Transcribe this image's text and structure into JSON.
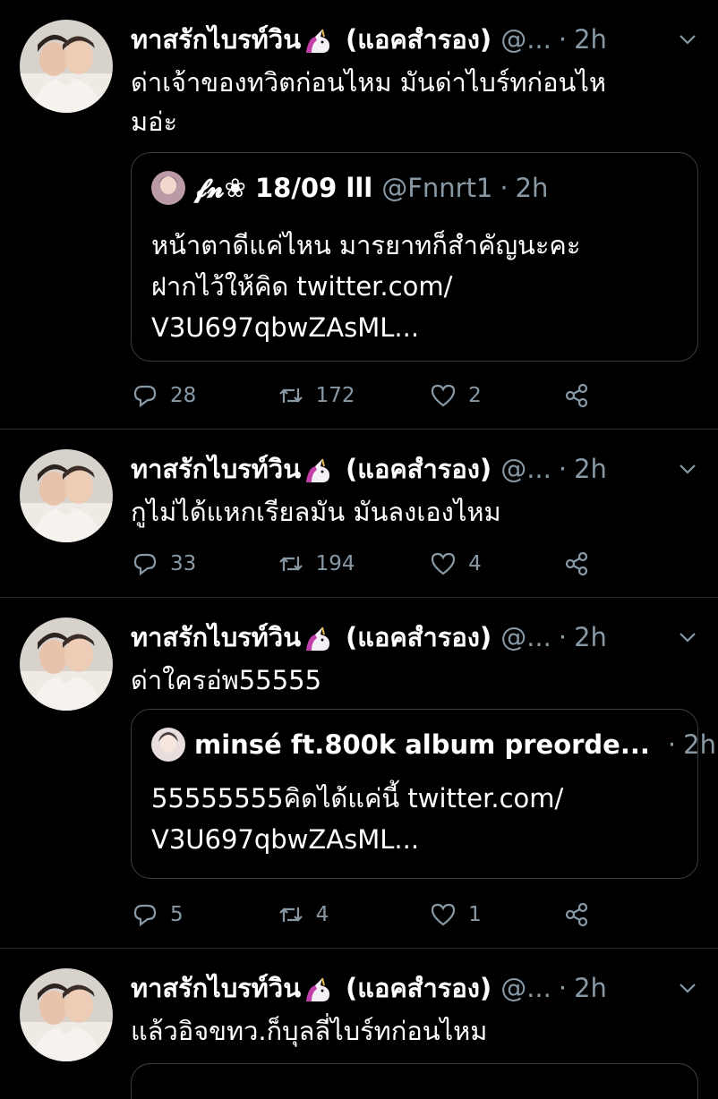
{
  "tweets": [
    {
      "display_name": "ทาสรักไบรท์วิน",
      "name_suffix": "(แอคสำรอง)",
      "handle": "@...",
      "time": "2h",
      "text_lines": [
        "ด่าเจ้าของทวิตก่อนไหม มันด่าไบร์ทก่อนไห",
        "มอ่ะ"
      ],
      "quote": {
        "display_name": "𝓯𝓷❀ 18/09 lll",
        "handle": "@Fnnrt1",
        "time": "2h",
        "text_lines": [
          "หน้าตาดีแค่ไหน มารยาทก็สำคัญนะคะ",
          "ฝากไว้ให้คิด twitter.com/",
          "V3U697qbwZAsML..."
        ]
      },
      "replies": "28",
      "retweets": "172",
      "likes": "2"
    },
    {
      "display_name": "ทาสรักไบรท์วิน",
      "name_suffix": "(แอคสำรอง)",
      "handle": "@...",
      "time": "2h",
      "text_lines": [
        "กูไม่ได้แหกเรียลมัน มันลงเองไหม"
      ],
      "replies": "33",
      "retweets": "194",
      "likes": "4"
    },
    {
      "display_name": "ทาสรักไบรท์วิน",
      "name_suffix": "(แอคสำรอง)",
      "handle": "@...",
      "time": "2h",
      "text_lines": [
        "ด่าใครอ่พ55555"
      ],
      "quote": {
        "display_name": "minsé ft.800k album preorde...",
        "handle": "",
        "time": "2h",
        "text_lines": [
          "55555555คิดได้แค่นี้ twitter.com/",
          "V3U697qbwZAsML..."
        ]
      },
      "replies": "5",
      "retweets": "4",
      "likes": "1"
    },
    {
      "display_name": "ทาสรักไบรท์วิน",
      "name_suffix": "(แอคสำรอง)",
      "handle": "@...",
      "time": "2h",
      "text_lines": [
        "แล้วอิจขทว.ก็บุลลี่ไบร์ทก่อนไหม"
      ]
    }
  ],
  "icons": {
    "reply": "reply-icon",
    "retweet": "retweet-icon",
    "like": "heart-icon",
    "share": "share-icon",
    "more": "chevron-down-icon",
    "emoji": "unicorn-icon"
  },
  "colors": {
    "background": "#000000",
    "text": "#ffffff",
    "secondary": "#8899a6",
    "border": "#2a2f34"
  }
}
